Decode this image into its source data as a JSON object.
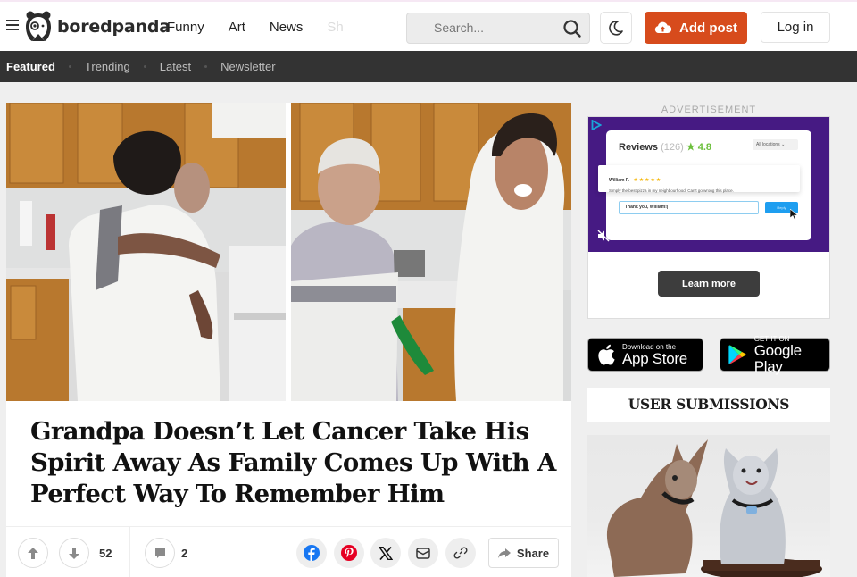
{
  "header": {
    "brand": "boredpanda",
    "nav": [
      "Funny",
      "Art",
      "News",
      "Sh"
    ],
    "search_placeholder": "Search...",
    "add_post_label": "Add post",
    "login_label": "Log in"
  },
  "subnav": {
    "items": [
      "Featured",
      "Trending",
      "Latest",
      "Newsletter"
    ],
    "active": "Featured"
  },
  "article": {
    "headline": "Grandpa Doesn’t Let Cancer Take His Spirit Away As Family Comes Up With A Perfect Way To Remember Him",
    "vote_count": "52",
    "comment_count": "2",
    "share_label": "Share"
  },
  "sidebar": {
    "ad_label": "ADVERTISEMENT",
    "ad": {
      "title": "Reviews",
      "review_count": "(126)",
      "rating": "★ 4.8",
      "location_select": "All locations ⌄",
      "reviewer": "William P.",
      "stars": "★★★★★",
      "quote": "Simply the best pizza in my neighbourhood! Can't go wrong this place.",
      "reply_input": "Thank you, William!|",
      "reply_button": "Reply",
      "cta": "Learn more"
    },
    "app_store": {
      "small": "Download on the",
      "big": "App Store"
    },
    "google_play": {
      "small": "GET IT ON",
      "big": "Google Play"
    },
    "user_submissions_title": "USER SUBMISSIONS"
  },
  "colors": {
    "accent": "#d74b1c",
    "subnav_bg": "#333333",
    "ad_purple": "#461a83",
    "facebook": "#1877f2",
    "pinterest": "#e60023"
  }
}
